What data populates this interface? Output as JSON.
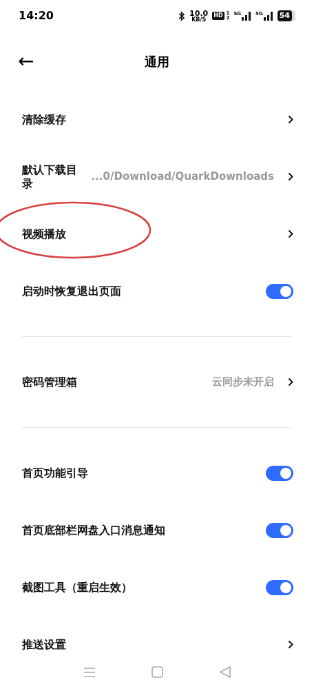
{
  "status_bar": {
    "time": "14:20",
    "speed": "10.0",
    "speed_unit": "KB/S",
    "hd": "HD",
    "hd_slots": [
      "1",
      "2"
    ],
    "networks": [
      "5G",
      "5G"
    ],
    "battery": "54"
  },
  "header": {
    "back": "←",
    "title": "通用"
  },
  "groups": [
    [
      {
        "kind": "link",
        "label": "清除缓存"
      },
      {
        "kind": "link",
        "label": "默认下载目录",
        "value": "...0/Download/QuarkDownloads"
      },
      {
        "kind": "link",
        "label": "视频播放",
        "circled": true
      },
      {
        "kind": "toggle",
        "label": "启动时恢复退出页面",
        "on": true
      }
    ],
    [
      {
        "kind": "link",
        "label": "密码管理箱",
        "value": "云同步未开启"
      }
    ],
    [
      {
        "kind": "toggle",
        "label": "首页功能引导",
        "on": true
      },
      {
        "kind": "toggle",
        "label": "首页底部栏网盘入口消息通知",
        "on": true
      },
      {
        "kind": "toggle",
        "label": "截图工具（重启生效）",
        "on": true
      },
      {
        "kind": "link",
        "label": "推送设置"
      }
    ]
  ]
}
